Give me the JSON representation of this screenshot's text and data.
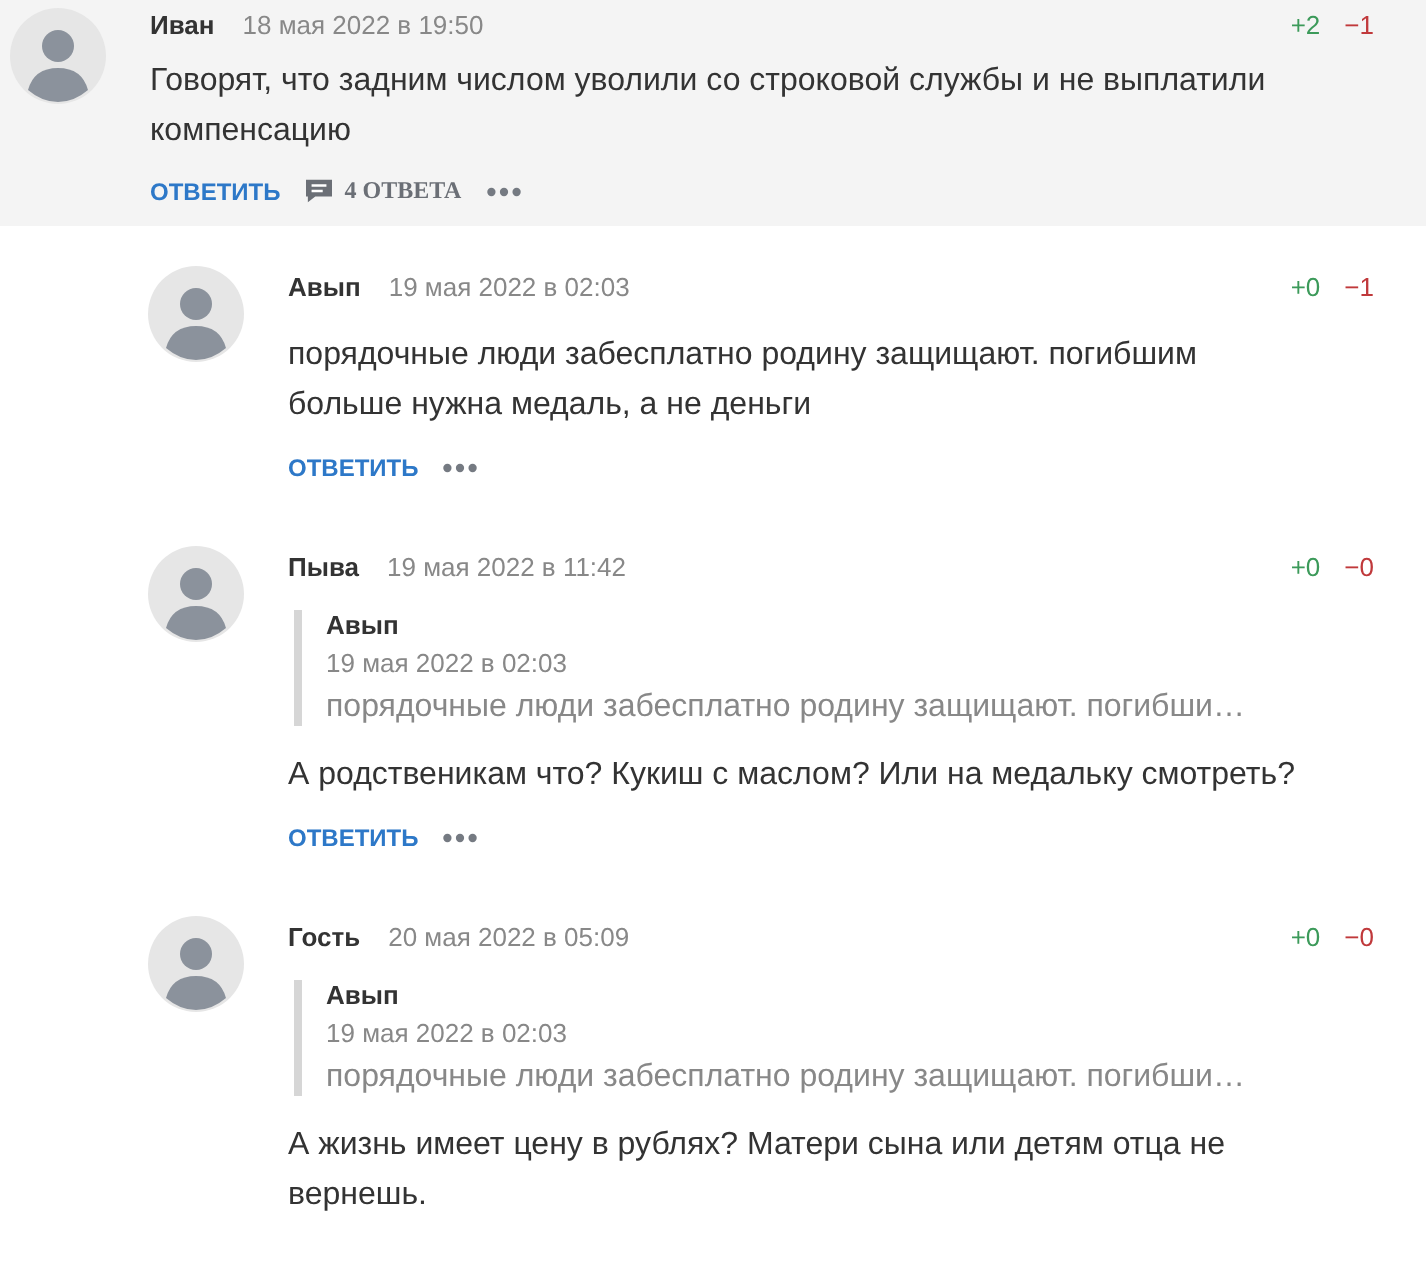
{
  "comments": [
    {
      "author": "Иван",
      "date": "18 мая 2022 в 19:50",
      "plus": "+2",
      "minus": "−1",
      "highlighted": true,
      "reply_button": "ОТВЕТИТЬ",
      "replies_count": "4 ОТВЕТА",
      "text": "Говорят, что задним числом уволили со строковой службы и не выплатили компенсацию",
      "replies": [
        {
          "author": "Авып",
          "date": "19 мая 2022 в 02:03",
          "plus": "+0",
          "minus": "−1",
          "reply_button": "ОТВЕТИТЬ",
          "text": "порядочные люди забесплатно родину защищают. погибшим больше нужна медаль, а не деньги"
        },
        {
          "author": "Пыва",
          "date": "19 мая 2022 в 11:42",
          "plus": "+0",
          "minus": "−0",
          "quote": {
            "author": "Авып",
            "date": "19 мая 2022 в 02:03",
            "text": "порядочные люди забесплатно родину защищают. погибши…"
          },
          "reply_button": "ОТВЕТИТЬ",
          "text": "А родственикам что? Кукиш с маслом? Или на медальку смотреть?"
        },
        {
          "author": "Гость",
          "date": "20 мая 2022 в 05:09",
          "plus": "+0",
          "minus": "−0",
          "quote": {
            "author": "Авып",
            "date": "19 мая 2022 в 02:03",
            "text": "порядочные люди забесплатно родину защищают. погибши…"
          },
          "text": "А жизнь имеет цену в рублях? Матери сына или детям отца не вернешь."
        }
      ]
    }
  ]
}
